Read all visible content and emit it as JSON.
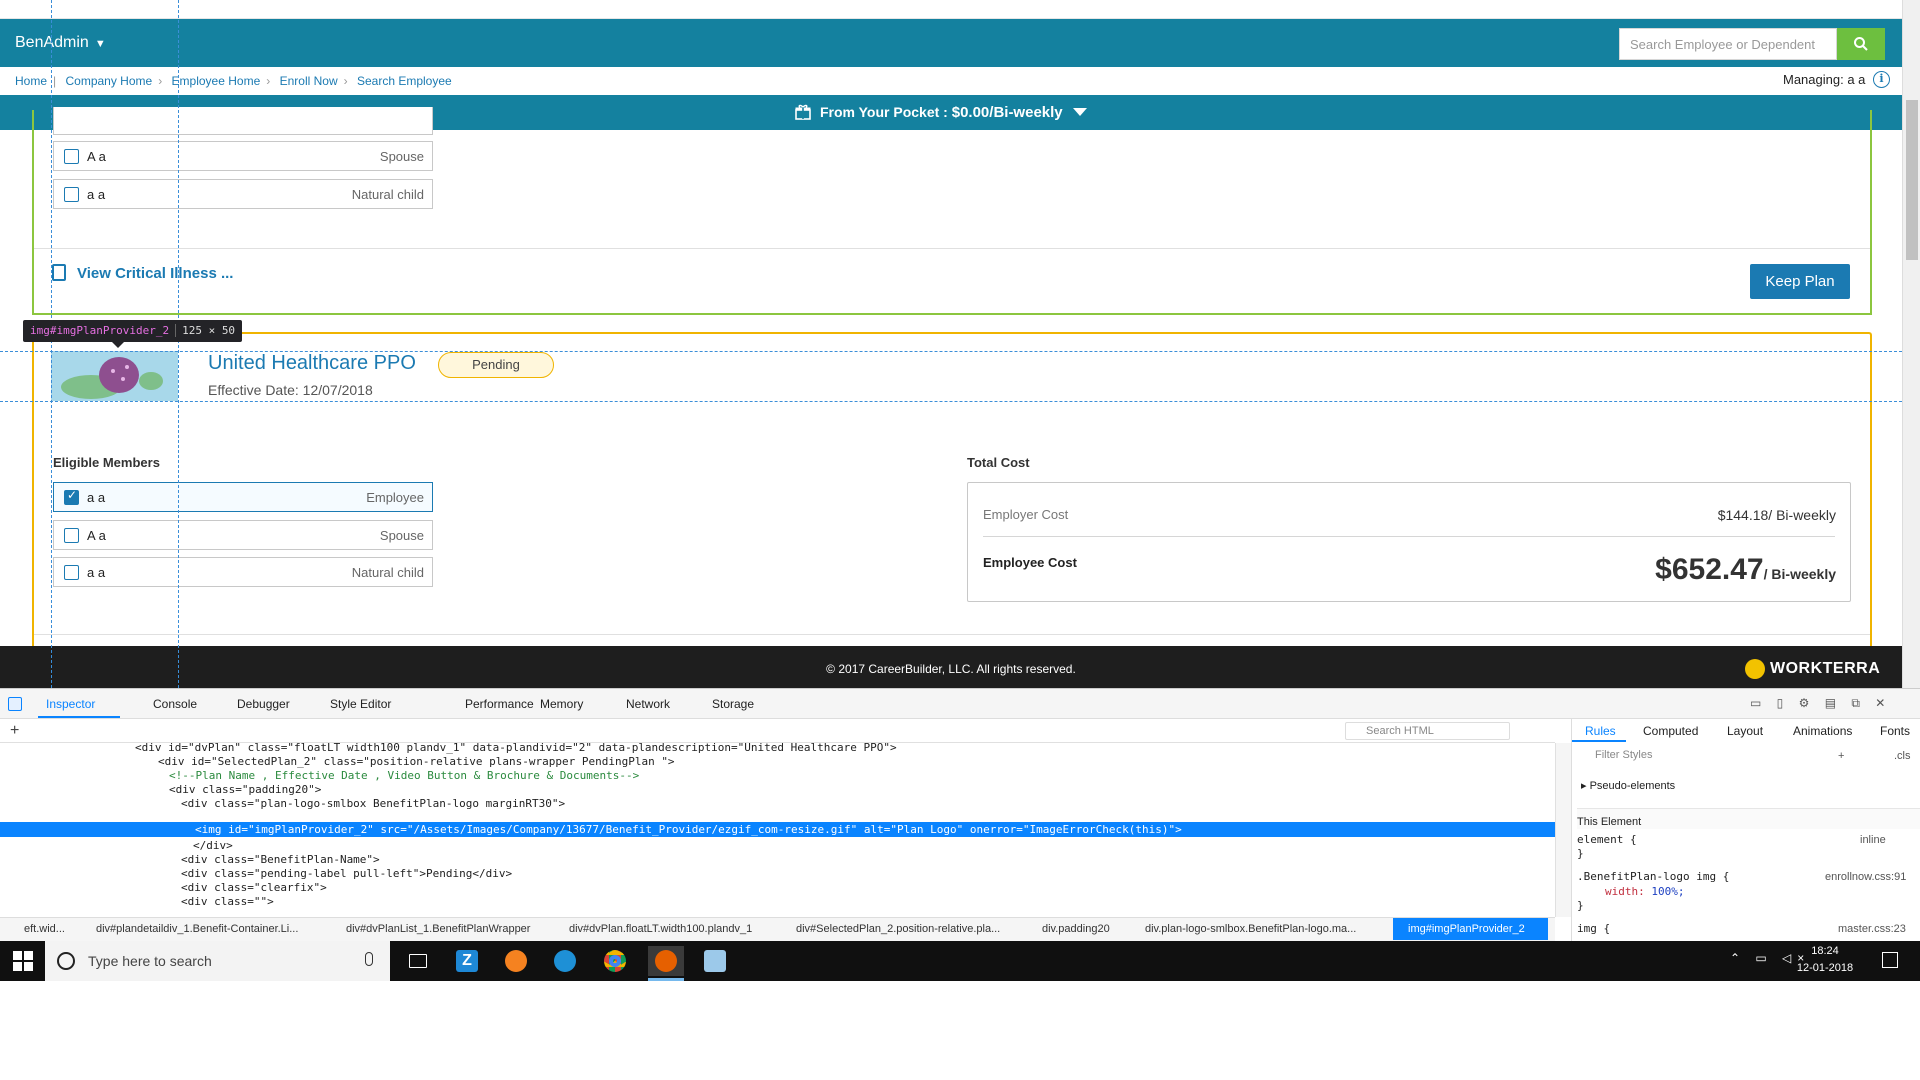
{
  "header": {
    "brand": "BenAdmin",
    "search_placeholder": "Search Employee or Dependent"
  },
  "breadcrumb": {
    "items": [
      "Home",
      "Company Home",
      "Employee Home",
      "Enroll Now",
      "Search Employee"
    ],
    "managing_label": "Managing:",
    "managing_value": "a a"
  },
  "pocket": {
    "label": "From Your Pocket :",
    "amount": "$0.00/Bi-weekly"
  },
  "plan1": {
    "members": [
      {
        "name": "A a",
        "relation": "Spouse",
        "checked": false
      },
      {
        "name": "a a",
        "relation": "Natural child",
        "checked": false
      }
    ],
    "view_link": "View Critical Illness ...",
    "keep_button": "Keep Plan"
  },
  "plan2": {
    "name": "United Healthcare PPO",
    "status": "Pending",
    "effective_date": "Effective Date: 12/07/2018",
    "eligible_label": "Eligible Members",
    "members": [
      {
        "name": "a a",
        "relation": "Employee",
        "checked": true
      },
      {
        "name": "A a",
        "relation": "Spouse",
        "checked": false
      },
      {
        "name": "a a",
        "relation": "Natural child",
        "checked": false
      }
    ],
    "total_cost_label": "Total Cost",
    "employer_cost_label": "Employer Cost",
    "employer_cost_value": "$144.18/ Bi-weekly",
    "employee_cost_label": "Employee Cost",
    "employee_cost_amount": "$652.47",
    "employee_cost_period": "/ Bi-weekly"
  },
  "footer": {
    "copyright": "© 2017 CareerBuilder, LLC. All rights reserved.",
    "logo_text": "WORKTERRA"
  },
  "overlay": {
    "tooltip_tag": "img#imgPlanProvider_2",
    "tooltip_dims": "125 × 50"
  },
  "devtools": {
    "tabs": [
      "Inspector",
      "Console",
      "Debugger",
      "Style Editor",
      "Performance",
      "Memory",
      "Network",
      "Storage"
    ],
    "search_html_placeholder": "Search HTML",
    "code_lines": [
      "<div id=\"dvPlan\" class=\"floatLT width100 plandv_1\" data-plandivid=\"2\" data-plandescription=\"United Healthcare PPO\">",
      "<div id=\"SelectedPlan_2\" class=\"position-relative plans-wrapper PendingPlan \">",
      "<!--Plan Name , Effective Date , Video Button & Brochure & Documents-->",
      "<div class=\"padding20\">",
      "<div class=\"plan-logo-smlbox BenefitPlan-logo marginRT30\">",
      "<img id=\"imgPlanProvider_2\" src=\"/Assets/Images/Company/13677/Benefit_Provider/ezgif_com-resize.gif\" alt=\"Plan Logo\" onerror=\"ImageErrorCheck(this)\">",
      "</div>",
      "<div class=\"BenefitPlan-Name\">",
      "<div class=\"pending-label pull-left\">Pending</div>",
      "<div class=\"clearfix\">",
      "<div class=\"\">"
    ],
    "node_breadcrumbs": [
      "eft.wid...",
      "div#plandetaildiv_1.Benefit-Container.Li...",
      "div#dvPlanList_1.BenefitPlanWrapper",
      "div#dvPlan.floatLT.width100.plandv_1",
      "div#SelectedPlan_2.position-relative.pla...",
      "div.padding20",
      "div.plan-logo-smlbox.BenefitPlan-logo.ma...",
      "img#imgPlanProvider_2"
    ],
    "rule_tabs": [
      "Rules",
      "Computed",
      "Layout",
      "Animations",
      "Fonts"
    ],
    "filter_placeholder": "Filter Styles",
    "filter_cls": ".cls",
    "pseudo_elements": "Pseudo-elements",
    "this_element": "This Element",
    "rule1_selector": "element",
    "rule1_source": "inline",
    "rule2_selector": ".BenefitPlan-logo img",
    "rule2_source": "enrollnow.css:91",
    "rule2_prop": "width:",
    "rule2_val": "100%;",
    "rule3_selector": "img",
    "rule3_source": "master.css:23"
  },
  "taskbar": {
    "search_placeholder": "Type here to search",
    "time": "18:24",
    "date": "12-01-2018"
  },
  "colors": {
    "header_teal": "#14819f",
    "link_blue": "#1b7ab2",
    "plan1_border": "#8cc63f",
    "plan2_border": "#f0b400",
    "search_green": "#6dbf3f",
    "devtools_blue": "#0a84ff"
  }
}
